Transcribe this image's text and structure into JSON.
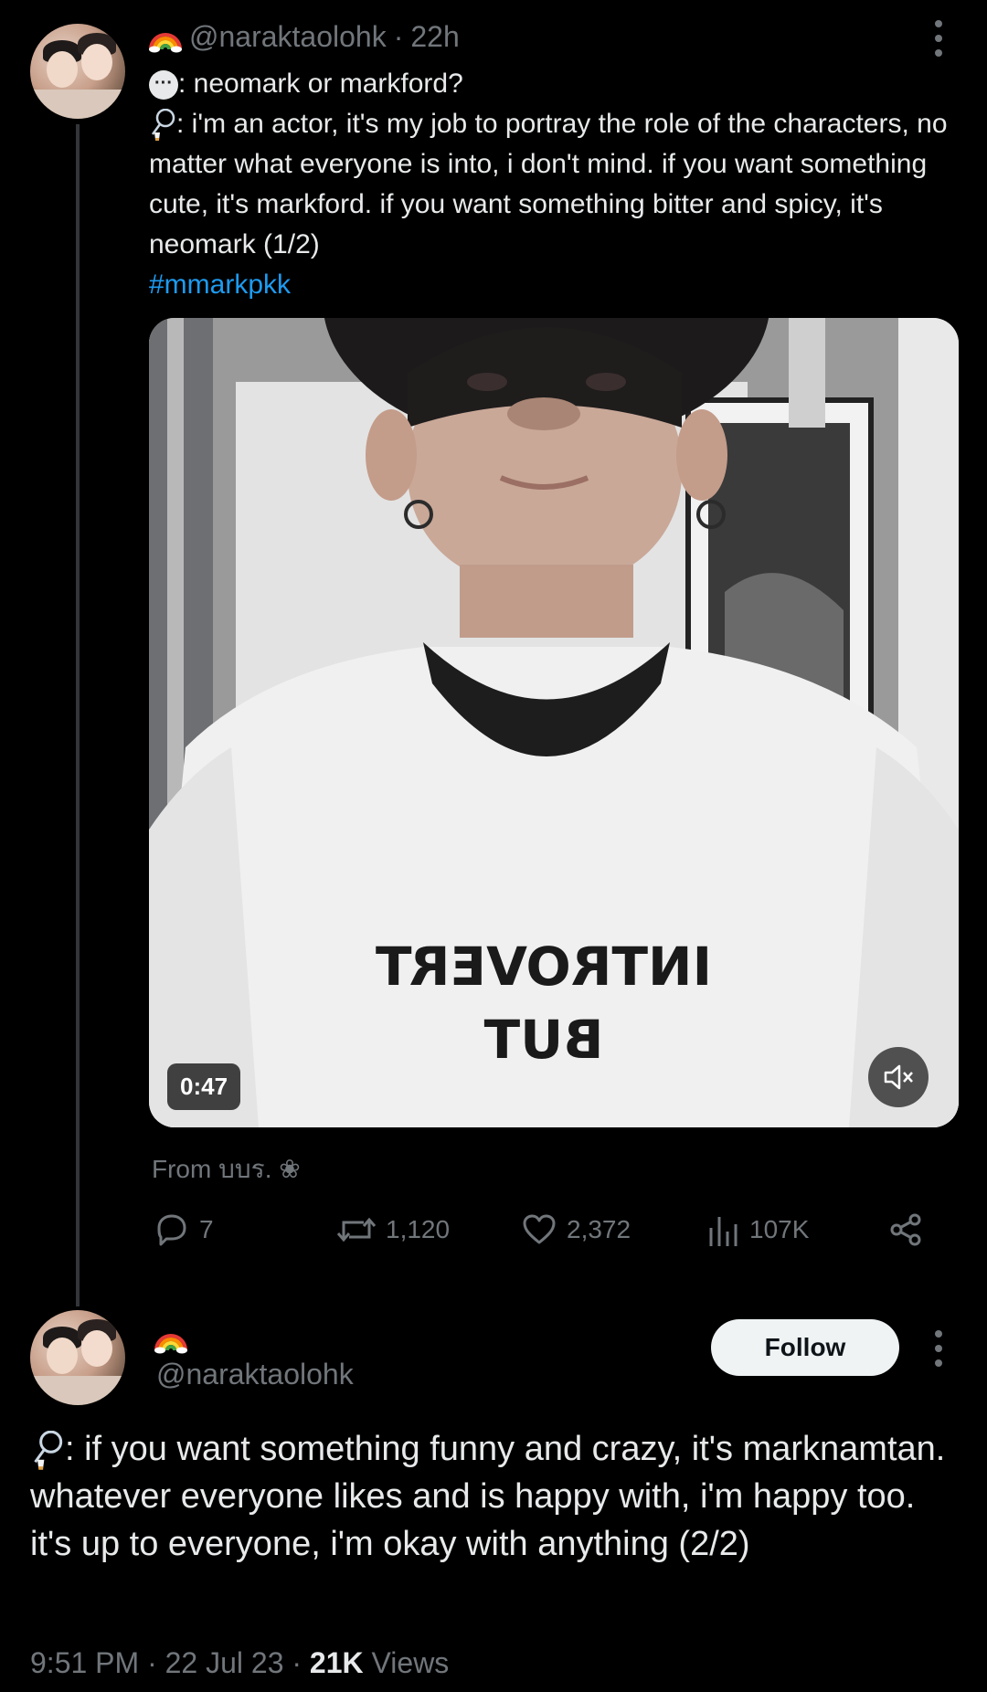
{
  "tweet1": {
    "handle": "@naraktaolohk",
    "sep": "·",
    "time": "22h",
    "line1": ": neomark or markford?",
    "line2": ": i'm an actor, it's my job to portray the role of the characters, no matter what everyone is into, i don't mind. if you want something cute, it's markford. if you want something bitter and spicy, it's neomark (1/2)",
    "hashtag": "#mmarkpkk",
    "video": {
      "duration": "0:47",
      "shirt_line1": "INTROVERT",
      "shirt_line2": "BUT"
    },
    "from": "From บบร. ❀",
    "stats": {
      "replies": "7",
      "reposts": "1,120",
      "likes": "2,372",
      "views": "107K"
    }
  },
  "tweet2": {
    "handle": "@naraktaolohk",
    "follow_label": "Follow",
    "text": ": if you want something funny and crazy, it's marknamtan. whatever everyone likes and is happy with, i'm happy too. it's up to everyone, i'm okay with anything (2/2)",
    "time": "9:51 PM",
    "date": "22 Jul 23",
    "views_count": "21K",
    "views_label": "Views",
    "sep": "·"
  },
  "icons": [
    "rainbow-icon",
    "speech-bubble-icon",
    "badminton-icon",
    "more-icon",
    "mute-icon",
    "reply-icon",
    "repost-icon",
    "like-icon",
    "views-icon",
    "share-icon"
  ],
  "colors": {
    "background": "#000000",
    "text": "#e7e9ea",
    "muted": "#71767b",
    "link": "#1d9bf0",
    "follow_bg": "#eff3f4"
  }
}
